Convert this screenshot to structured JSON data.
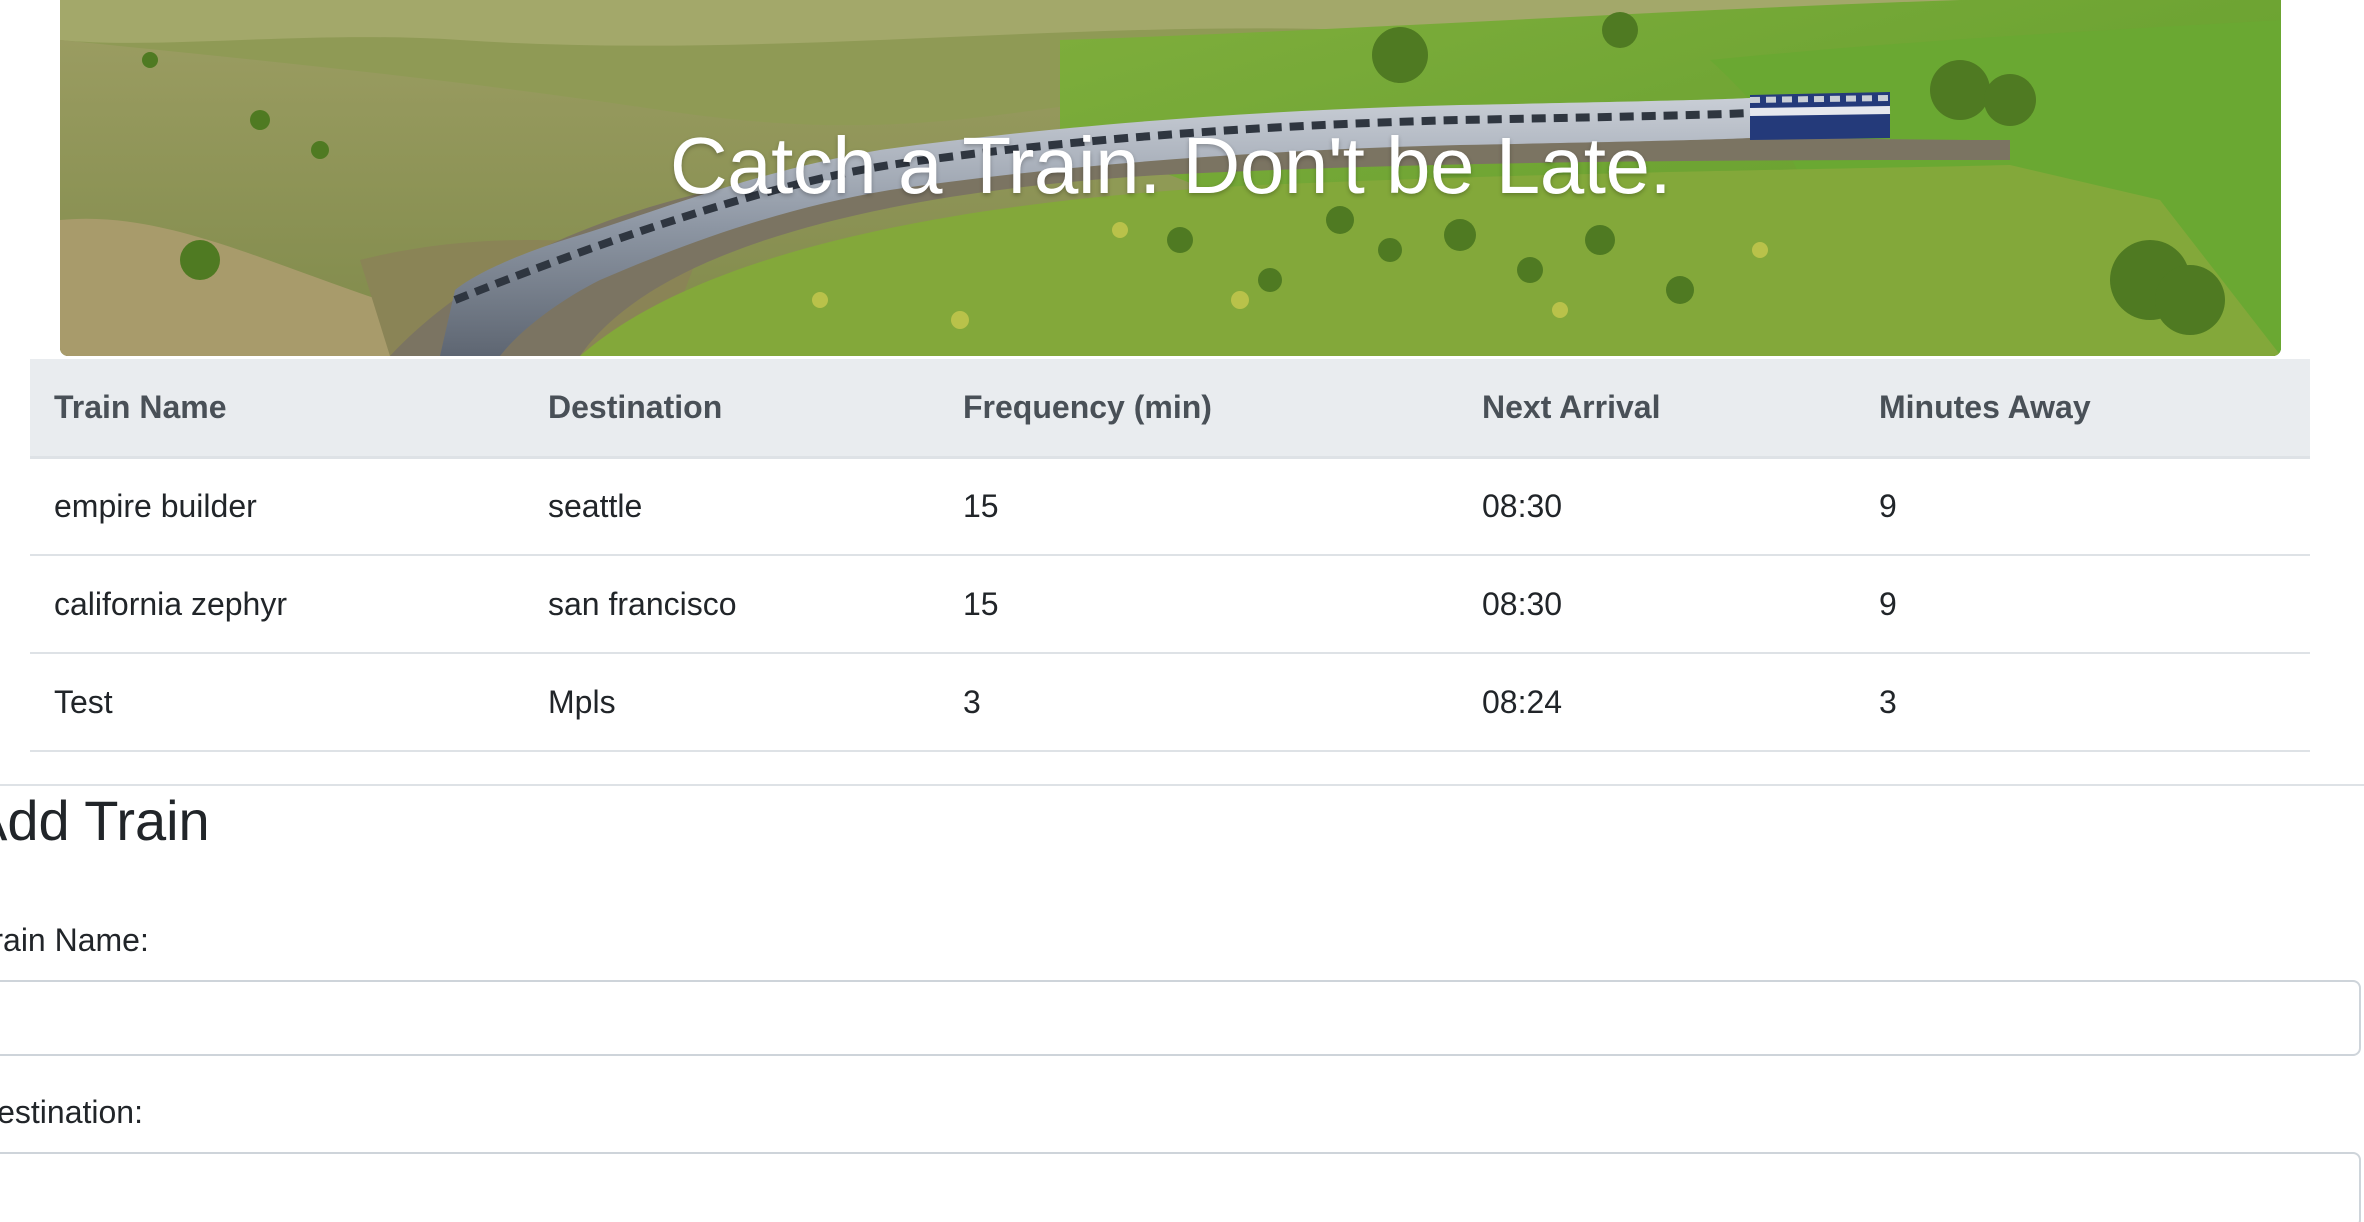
{
  "hero": {
    "title": "Catch a Train. Don't be Late."
  },
  "schedule": {
    "headers": [
      "Train Name",
      "Destination",
      "Frequency (min)",
      "Next Arrival",
      "Minutes Away"
    ],
    "rows": [
      [
        "empire builder",
        "seattle",
        "15",
        "08:30",
        "9"
      ],
      [
        "california zephyr",
        "san francisco",
        "15",
        "08:30",
        "9"
      ],
      [
        "Test",
        "Mpls",
        "3",
        "08:24",
        "3"
      ]
    ]
  },
  "form": {
    "title": "Add Train",
    "fields": [
      {
        "label": "Train Name:",
        "value": ""
      },
      {
        "label": "Destination:",
        "value": ""
      }
    ]
  }
}
